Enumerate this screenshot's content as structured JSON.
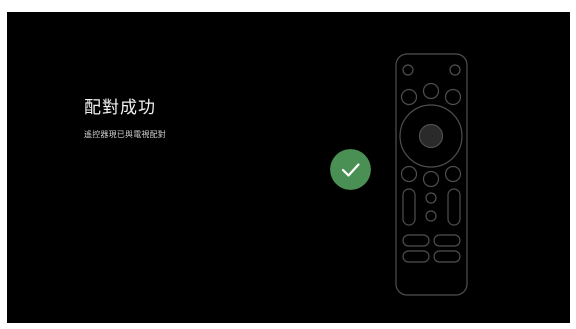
{
  "pairing": {
    "title": "配對成功",
    "message": "遙控器現已與電視配對"
  },
  "icons": {
    "success": "checkmark-icon",
    "remote": "remote-control-icon"
  },
  "colors": {
    "background": "#000000",
    "success_badge": "#4a8f54",
    "remote_outline": "#4f4f4f"
  }
}
